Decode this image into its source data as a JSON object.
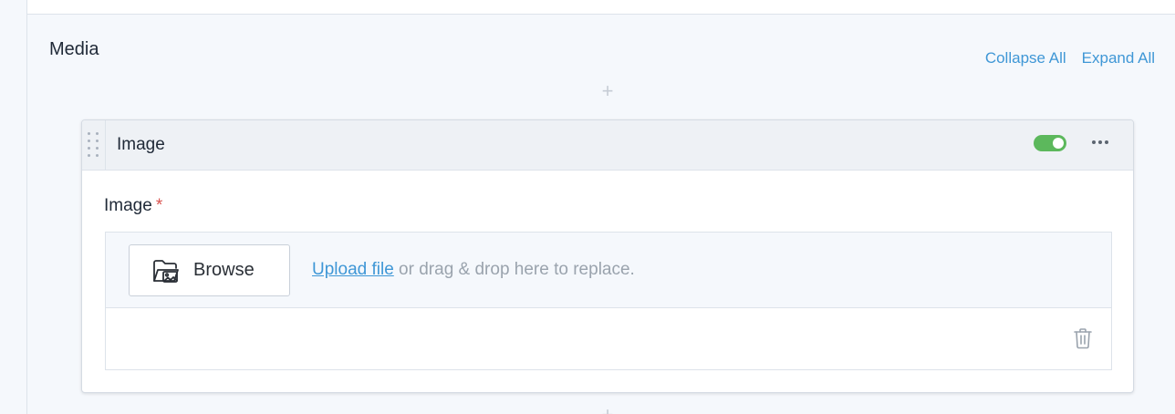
{
  "section": {
    "title": "Media",
    "collapse_all": "Collapse All",
    "expand_all": "Expand All",
    "add_symbol": "+"
  },
  "block": {
    "title": "Image",
    "enabled": true,
    "toggle_color": "#5cb85c"
  },
  "field": {
    "label": "Image",
    "required_mark": "*",
    "browse_label": "Browse",
    "upload_link": "Upload file",
    "upload_hint": " or drag & drop here to replace."
  },
  "icons": {
    "drag": "drag-handle-icon",
    "more": "more-horizontal-icon",
    "browse": "folder-image-icon",
    "delete": "trash-icon",
    "add": "plus-icon"
  },
  "colors": {
    "link": "#3f97d6",
    "required": "#d9534f"
  }
}
